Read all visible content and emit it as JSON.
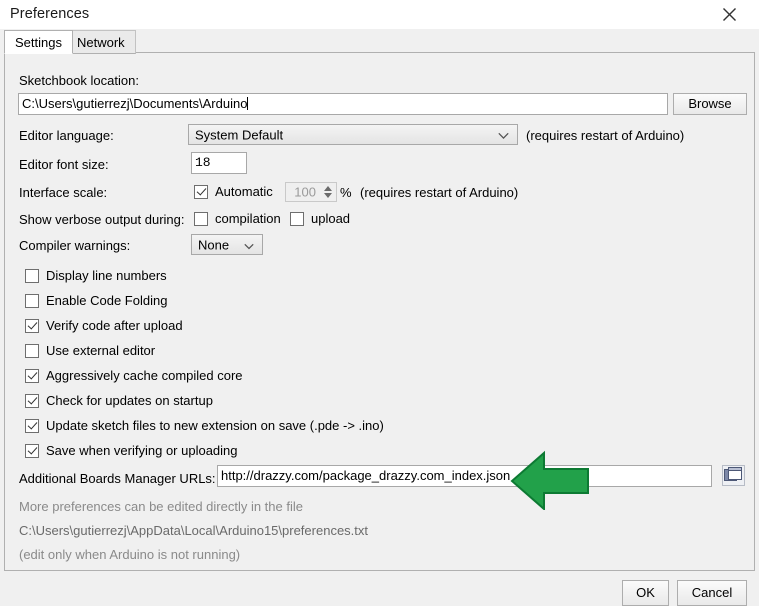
{
  "window": {
    "title": "Preferences",
    "close_icon": "close-icon"
  },
  "tabs": [
    {
      "label": "Settings",
      "selected": true
    },
    {
      "label": "Network",
      "selected": false
    }
  ],
  "settings": {
    "sketchbook": {
      "label": "Sketchbook location:",
      "value": "C:\\Users\\gutierrezj\\Documents\\Arduino",
      "browse_label": "Browse"
    },
    "editor_language": {
      "label": "Editor language:",
      "value": "System Default",
      "note": "(requires restart of Arduino)",
      "chevron_icon": "chevron-down-icon"
    },
    "editor_font_size": {
      "label": "Editor font size:",
      "value": "18"
    },
    "interface_scale": {
      "label": "Interface scale:",
      "automatic_label": "Automatic",
      "automatic_checked": true,
      "value": "100",
      "percent": "%",
      "note": "(requires restart of Arduino)",
      "spinner_disabled": true
    },
    "verbose_output": {
      "label": "Show verbose output during:",
      "compilation_label": "compilation",
      "compilation_checked": false,
      "upload_label": "upload",
      "upload_checked": false
    },
    "compiler_warnings": {
      "label": "Compiler warnings:",
      "value": "None",
      "chevron_icon": "chevron-down-icon"
    },
    "checkboxes": [
      {
        "label": "Display line numbers",
        "checked": false
      },
      {
        "label": "Enable Code Folding",
        "checked": false
      },
      {
        "label": "Verify code after upload",
        "checked": true
      },
      {
        "label": "Use external editor",
        "checked": false
      },
      {
        "label": "Aggressively cache compiled core",
        "checked": true
      },
      {
        "label": "Check for updates on startup",
        "checked": true
      },
      {
        "label": "Update sketch files to new extension on save (.pde -> .ino)",
        "checked": true
      },
      {
        "label": "Save when verifying or uploading",
        "checked": true
      }
    ],
    "boards_manager": {
      "label": "Additional Boards Manager URLs:",
      "value": "http://drazzy.com/package_drazzy.com_index.json",
      "icon": "external-window-icon"
    },
    "footer": {
      "line1": "More preferences can be edited directly in the file",
      "line2": "C:\\Users\\gutierrezj\\AppData\\Local\\Arduino15\\preferences.txt",
      "line3": "(edit only when Arduino is not running)"
    }
  },
  "dialog_buttons": {
    "ok_label": "OK",
    "cancel_label": "Cancel"
  },
  "annotation": {
    "type": "left-pointing-arrow",
    "color": "#22a14a",
    "outline": "#0d7a33"
  }
}
